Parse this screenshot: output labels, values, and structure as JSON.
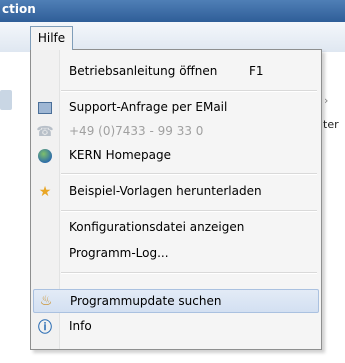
{
  "window": {
    "title_fragment": "ction"
  },
  "menubar": {
    "active_menu": "Hilfe"
  },
  "background": {
    "right_text_1": "›",
    "right_text_2": "lter"
  },
  "menu": {
    "items": [
      {
        "label": "Betriebsanleitung öffnen",
        "shortcut": "F1",
        "icon": "none",
        "enabled": true
      },
      {
        "label": "Support-Anfrage per EMail",
        "icon": "email-icon",
        "enabled": true
      },
      {
        "label": "+49 (0)7433 - 99 33 0",
        "icon": "phone-icon",
        "enabled": false
      },
      {
        "label": "KERN Homepage",
        "icon": "globe-icon",
        "enabled": true
      },
      {
        "label": "Beispiel-Vorlagen herunterladen",
        "icon": "download-templates-icon",
        "enabled": true
      },
      {
        "label": "Konfigurationsdatei anzeigen",
        "icon": "none",
        "enabled": true
      },
      {
        "label": "Programm-Log...",
        "icon": "none",
        "enabled": true
      },
      {
        "label": "Programmupdate suchen",
        "icon": "update-icon",
        "enabled": true,
        "highlighted": true
      },
      {
        "label": "Info",
        "icon": "info-icon",
        "enabled": true
      }
    ]
  }
}
